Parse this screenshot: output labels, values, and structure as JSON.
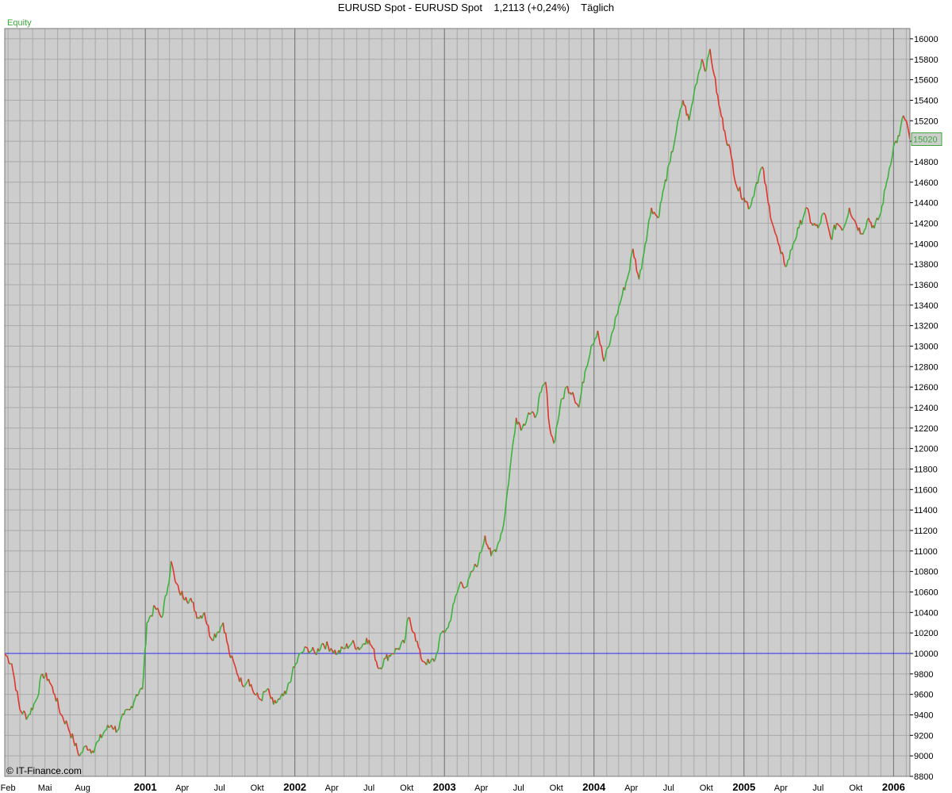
{
  "header": {
    "title": "EURUSD Spot - EURUSD Spot",
    "price": "1,2113 (+0,24%)",
    "period": "Täglich"
  },
  "panel": {
    "series_label": "Equity",
    "watermark": "© IT-Finance.com",
    "last_value_label": "15020"
  },
  "colors": {
    "background": "#cdcdcd",
    "grid": "#a9a9a9",
    "year_grid": "#6e6e6e",
    "up": "#3cb23c",
    "down": "#e0352b",
    "baseline": "#2a2af0",
    "label_green": "#3aa83a"
  },
  "chart_data": {
    "type": "line",
    "title": "",
    "xlabel": "",
    "ylabel": "",
    "ylim": [
      8800,
      16100
    ],
    "y_ticks": [
      8800,
      9000,
      9200,
      9400,
      9600,
      9800,
      10000,
      10200,
      10400,
      10600,
      10800,
      11000,
      11200,
      11400,
      11600,
      11800,
      12000,
      12200,
      12400,
      12600,
      12800,
      13000,
      13200,
      13400,
      13600,
      13800,
      14000,
      14200,
      14400,
      14600,
      14800,
      15000,
      15200,
      15400,
      15600,
      15800,
      16000
    ],
    "x_range": [
      "2000-01-24",
      "2006-02-10"
    ],
    "x_tick_labels": [
      {
        "date": "2000-02-01",
        "label": "Feb",
        "major": false
      },
      {
        "date": "2000-05-01",
        "label": "Mai",
        "major": false
      },
      {
        "date": "2000-08-01",
        "label": "Aug",
        "major": false
      },
      {
        "date": "2001-01-01",
        "label": "2001",
        "major": true
      },
      {
        "date": "2001-04-01",
        "label": "Apr",
        "major": false
      },
      {
        "date": "2001-07-01",
        "label": "Jul",
        "major": false
      },
      {
        "date": "2001-10-01",
        "label": "Okt",
        "major": false
      },
      {
        "date": "2002-01-01",
        "label": "2002",
        "major": true
      },
      {
        "date": "2002-04-01",
        "label": "Apr",
        "major": false
      },
      {
        "date": "2002-07-01",
        "label": "Jul",
        "major": false
      },
      {
        "date": "2002-10-01",
        "label": "Okt",
        "major": false
      },
      {
        "date": "2003-01-01",
        "label": "2003",
        "major": true
      },
      {
        "date": "2003-04-01",
        "label": "Apr",
        "major": false
      },
      {
        "date": "2003-07-01",
        "label": "Jul",
        "major": false
      },
      {
        "date": "2003-10-01",
        "label": "Okt",
        "major": false
      },
      {
        "date": "2004-01-01",
        "label": "2004",
        "major": true
      },
      {
        "date": "2004-04-01",
        "label": "Apr",
        "major": false
      },
      {
        "date": "2004-07-01",
        "label": "Jul",
        "major": false
      },
      {
        "date": "2004-10-01",
        "label": "Okt",
        "major": false
      },
      {
        "date": "2005-01-01",
        "label": "2005",
        "major": true
      },
      {
        "date": "2005-04-01",
        "label": "Apr",
        "major": false
      },
      {
        "date": "2005-07-01",
        "label": "Jul",
        "major": false
      },
      {
        "date": "2005-10-01",
        "label": "Okt",
        "major": false
      },
      {
        "date": "2006-01-01",
        "label": "2006",
        "major": true
      }
    ],
    "baseline": 10000,
    "grid": true,
    "series": [
      {
        "values": [
          [
            "2000-01-24",
            10000
          ],
          [
            "2000-02-10",
            9900
          ],
          [
            "2000-03-01",
            9450
          ],
          [
            "2000-03-20",
            9380
          ],
          [
            "2000-04-10",
            9550
          ],
          [
            "2000-04-25",
            9800
          ],
          [
            "2000-05-10",
            9750
          ],
          [
            "2000-05-25",
            9600
          ],
          [
            "2000-06-10",
            9400
          ],
          [
            "2000-06-25",
            9300
          ],
          [
            "2000-07-10",
            9150
          ],
          [
            "2000-07-25",
            9000
          ],
          [
            "2000-08-10",
            9100
          ],
          [
            "2000-08-25",
            9050
          ],
          [
            "2000-09-10",
            9150
          ],
          [
            "2000-09-25",
            9250
          ],
          [
            "2000-10-10",
            9300
          ],
          [
            "2000-10-25",
            9250
          ],
          [
            "2000-11-10",
            9400
          ],
          [
            "2000-11-25",
            9450
          ],
          [
            "2000-12-10",
            9600
          ],
          [
            "2000-12-25",
            9650
          ],
          [
            "2001-01-05",
            10300
          ],
          [
            "2001-01-25",
            10450
          ],
          [
            "2001-02-10",
            10350
          ],
          [
            "2001-02-25",
            10650
          ],
          [
            "2001-03-05",
            10900
          ],
          [
            "2001-03-15",
            10700
          ],
          [
            "2001-03-25",
            10600
          ],
          [
            "2001-04-10",
            10550
          ],
          [
            "2001-04-25",
            10500
          ],
          [
            "2001-05-10",
            10350
          ],
          [
            "2001-05-25",
            10400
          ],
          [
            "2001-06-10",
            10150
          ],
          [
            "2001-06-25",
            10200
          ],
          [
            "2001-07-10",
            10300
          ],
          [
            "2001-07-25",
            10000
          ],
          [
            "2001-08-10",
            9850
          ],
          [
            "2001-08-25",
            9700
          ],
          [
            "2001-09-10",
            9750
          ],
          [
            "2001-09-25",
            9600
          ],
          [
            "2001-10-10",
            9550
          ],
          [
            "2001-10-25",
            9650
          ],
          [
            "2001-11-10",
            9500
          ],
          [
            "2001-11-25",
            9550
          ],
          [
            "2001-12-10",
            9600
          ],
          [
            "2001-12-25",
            9800
          ],
          [
            "2002-01-15",
            10000
          ],
          [
            "2002-02-01",
            10050
          ],
          [
            "2002-02-20",
            10000
          ],
          [
            "2002-03-10",
            10100
          ],
          [
            "2002-03-30",
            10050
          ],
          [
            "2002-04-15",
            10000
          ],
          [
            "2002-05-01",
            10050
          ],
          [
            "2002-05-20",
            10100
          ],
          [
            "2002-06-10",
            10050
          ],
          [
            "2002-06-25",
            10150
          ],
          [
            "2002-07-10",
            10050
          ],
          [
            "2002-07-25",
            9850
          ],
          [
            "2002-08-10",
            9950
          ],
          [
            "2002-08-25",
            10000
          ],
          [
            "2002-09-10",
            10050
          ],
          [
            "2002-09-25",
            10100
          ],
          [
            "2002-10-05",
            10350
          ],
          [
            "2002-10-20",
            10200
          ],
          [
            "2002-11-05",
            9950
          ],
          [
            "2002-11-25",
            9900
          ],
          [
            "2002-12-10",
            9950
          ],
          [
            "2002-12-25",
            10200
          ],
          [
            "2003-01-10",
            10250
          ],
          [
            "2003-01-25",
            10500
          ],
          [
            "2003-02-10",
            10700
          ],
          [
            "2003-02-25",
            10650
          ],
          [
            "2003-03-10",
            10800
          ],
          [
            "2003-03-25",
            10900
          ],
          [
            "2003-04-10",
            11150
          ],
          [
            "2003-04-25",
            10950
          ],
          [
            "2003-05-10",
            11050
          ],
          [
            "2003-05-25",
            11250
          ],
          [
            "2003-06-10",
            11800
          ],
          [
            "2003-06-25",
            12300
          ],
          [
            "2003-07-10",
            12200
          ],
          [
            "2003-07-25",
            12350
          ],
          [
            "2003-08-10",
            12300
          ],
          [
            "2003-08-25",
            12550
          ],
          [
            "2003-09-05",
            12650
          ],
          [
            "2003-09-15",
            12200
          ],
          [
            "2003-09-25",
            12050
          ],
          [
            "2003-10-10",
            12400
          ],
          [
            "2003-10-25",
            12600
          ],
          [
            "2003-11-10",
            12550
          ],
          [
            "2003-11-25",
            12400
          ],
          [
            "2003-12-10",
            12750
          ],
          [
            "2003-12-25",
            13000
          ],
          [
            "2004-01-10",
            13150
          ],
          [
            "2004-01-25",
            12850
          ],
          [
            "2004-02-10",
            13050
          ],
          [
            "2004-02-25",
            13300
          ],
          [
            "2004-03-10",
            13500
          ],
          [
            "2004-03-25",
            13700
          ],
          [
            "2004-04-05",
            13950
          ],
          [
            "2004-04-20",
            13650
          ],
          [
            "2004-05-05",
            14000
          ],
          [
            "2004-05-20",
            14350
          ],
          [
            "2004-06-05",
            14250
          ],
          [
            "2004-06-20",
            14550
          ],
          [
            "2004-07-05",
            14800
          ],
          [
            "2004-07-20",
            15100
          ],
          [
            "2004-08-05",
            15400
          ],
          [
            "2004-08-20",
            15200
          ],
          [
            "2004-09-05",
            15550
          ],
          [
            "2004-09-20",
            15800
          ],
          [
            "2004-10-01",
            15700
          ],
          [
            "2004-10-10",
            15900
          ],
          [
            "2004-10-20",
            15650
          ],
          [
            "2004-11-01",
            15350
          ],
          [
            "2004-11-15",
            15100
          ],
          [
            "2004-12-01",
            14850
          ],
          [
            "2004-12-15",
            14550
          ],
          [
            "2005-01-01",
            14450
          ],
          [
            "2005-01-15",
            14350
          ],
          [
            "2005-02-01",
            14600
          ],
          [
            "2005-02-15",
            14750
          ],
          [
            "2005-03-01",
            14400
          ],
          [
            "2005-03-15",
            14150
          ],
          [
            "2005-04-01",
            13900
          ],
          [
            "2005-04-15",
            13780
          ],
          [
            "2005-05-01",
            14000
          ],
          [
            "2005-05-15",
            14150
          ],
          [
            "2005-06-01",
            14350
          ],
          [
            "2005-06-15",
            14200
          ],
          [
            "2005-07-01",
            14150
          ],
          [
            "2005-07-15",
            14300
          ],
          [
            "2005-08-01",
            14050
          ],
          [
            "2005-08-15",
            14200
          ],
          [
            "2005-09-01",
            14150
          ],
          [
            "2005-09-15",
            14350
          ],
          [
            "2005-10-01",
            14200
          ],
          [
            "2005-10-15",
            14100
          ],
          [
            "2005-11-01",
            14250
          ],
          [
            "2005-11-15",
            14150
          ],
          [
            "2005-12-01",
            14300
          ],
          [
            "2005-12-15",
            14600
          ],
          [
            "2006-01-01",
            14950
          ],
          [
            "2006-01-15",
            15050
          ],
          [
            "2006-01-25",
            15250
          ],
          [
            "2006-02-01",
            15200
          ],
          [
            "2006-02-10",
            15020
          ]
        ]
      }
    ]
  }
}
